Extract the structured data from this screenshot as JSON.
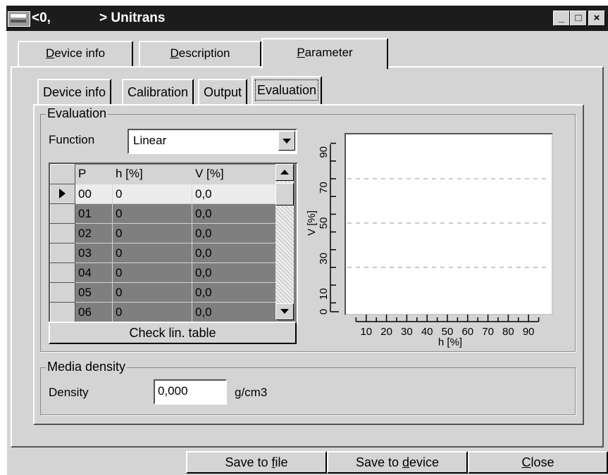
{
  "window": {
    "title_prefix": "<0,",
    "title": "> Unitrans",
    "buttons": {
      "minimize": "_",
      "maximize": "□",
      "close": "×"
    }
  },
  "top_tabs": {
    "device_info": {
      "u": "D",
      "rest": "evice info"
    },
    "description": {
      "u": "D",
      "rest": "escription"
    },
    "parameter": {
      "u": "P",
      "rest": "arameter"
    }
  },
  "inner_tabs": [
    "Device info",
    "Calibration",
    "Output",
    "Evaluation"
  ],
  "evaluation": {
    "group_label": "Evaluation",
    "function_label": "Function",
    "function_value": "Linear",
    "table": {
      "headers": [
        "P",
        "h [%]",
        "V [%]"
      ],
      "rows": [
        [
          "00",
          "0",
          "0,0"
        ],
        [
          "01",
          "0",
          "0,0"
        ],
        [
          "02",
          "0",
          "0,0"
        ],
        [
          "03",
          "0",
          "0,0"
        ],
        [
          "04",
          "0",
          "0,0"
        ],
        [
          "05",
          "0",
          "0,0"
        ],
        [
          "06",
          "0",
          "0,0"
        ]
      ]
    },
    "check_button": "Check lin. table"
  },
  "chart_data": {
    "type": "line",
    "xlabel": "h [%]",
    "ylabel": "V [%]",
    "x_tick_labels": [
      "10",
      "20",
      "30",
      "40",
      "50",
      "60",
      "70",
      "80",
      "90"
    ],
    "y_tick_labels": [
      "0",
      "10",
      "30",
      "50",
      "70",
      "90"
    ],
    "xlim": [
      0,
      100
    ],
    "ylim": [
      0,
      100
    ],
    "grid_lines_y": [
      25,
      50,
      75
    ],
    "series": []
  },
  "media_density": {
    "group_label": "Media density",
    "density_label": "Density",
    "density_value": "0,000",
    "unit": "g/cm3"
  },
  "bottom_buttons": {
    "save_file": {
      "pre": "Save to ",
      "u": "f",
      "post": "ile"
    },
    "save_device": {
      "pre": "Save to ",
      "u": "d",
      "post": "evice"
    },
    "close": {
      "pre": "",
      "u": "C",
      "post": "lose"
    }
  }
}
